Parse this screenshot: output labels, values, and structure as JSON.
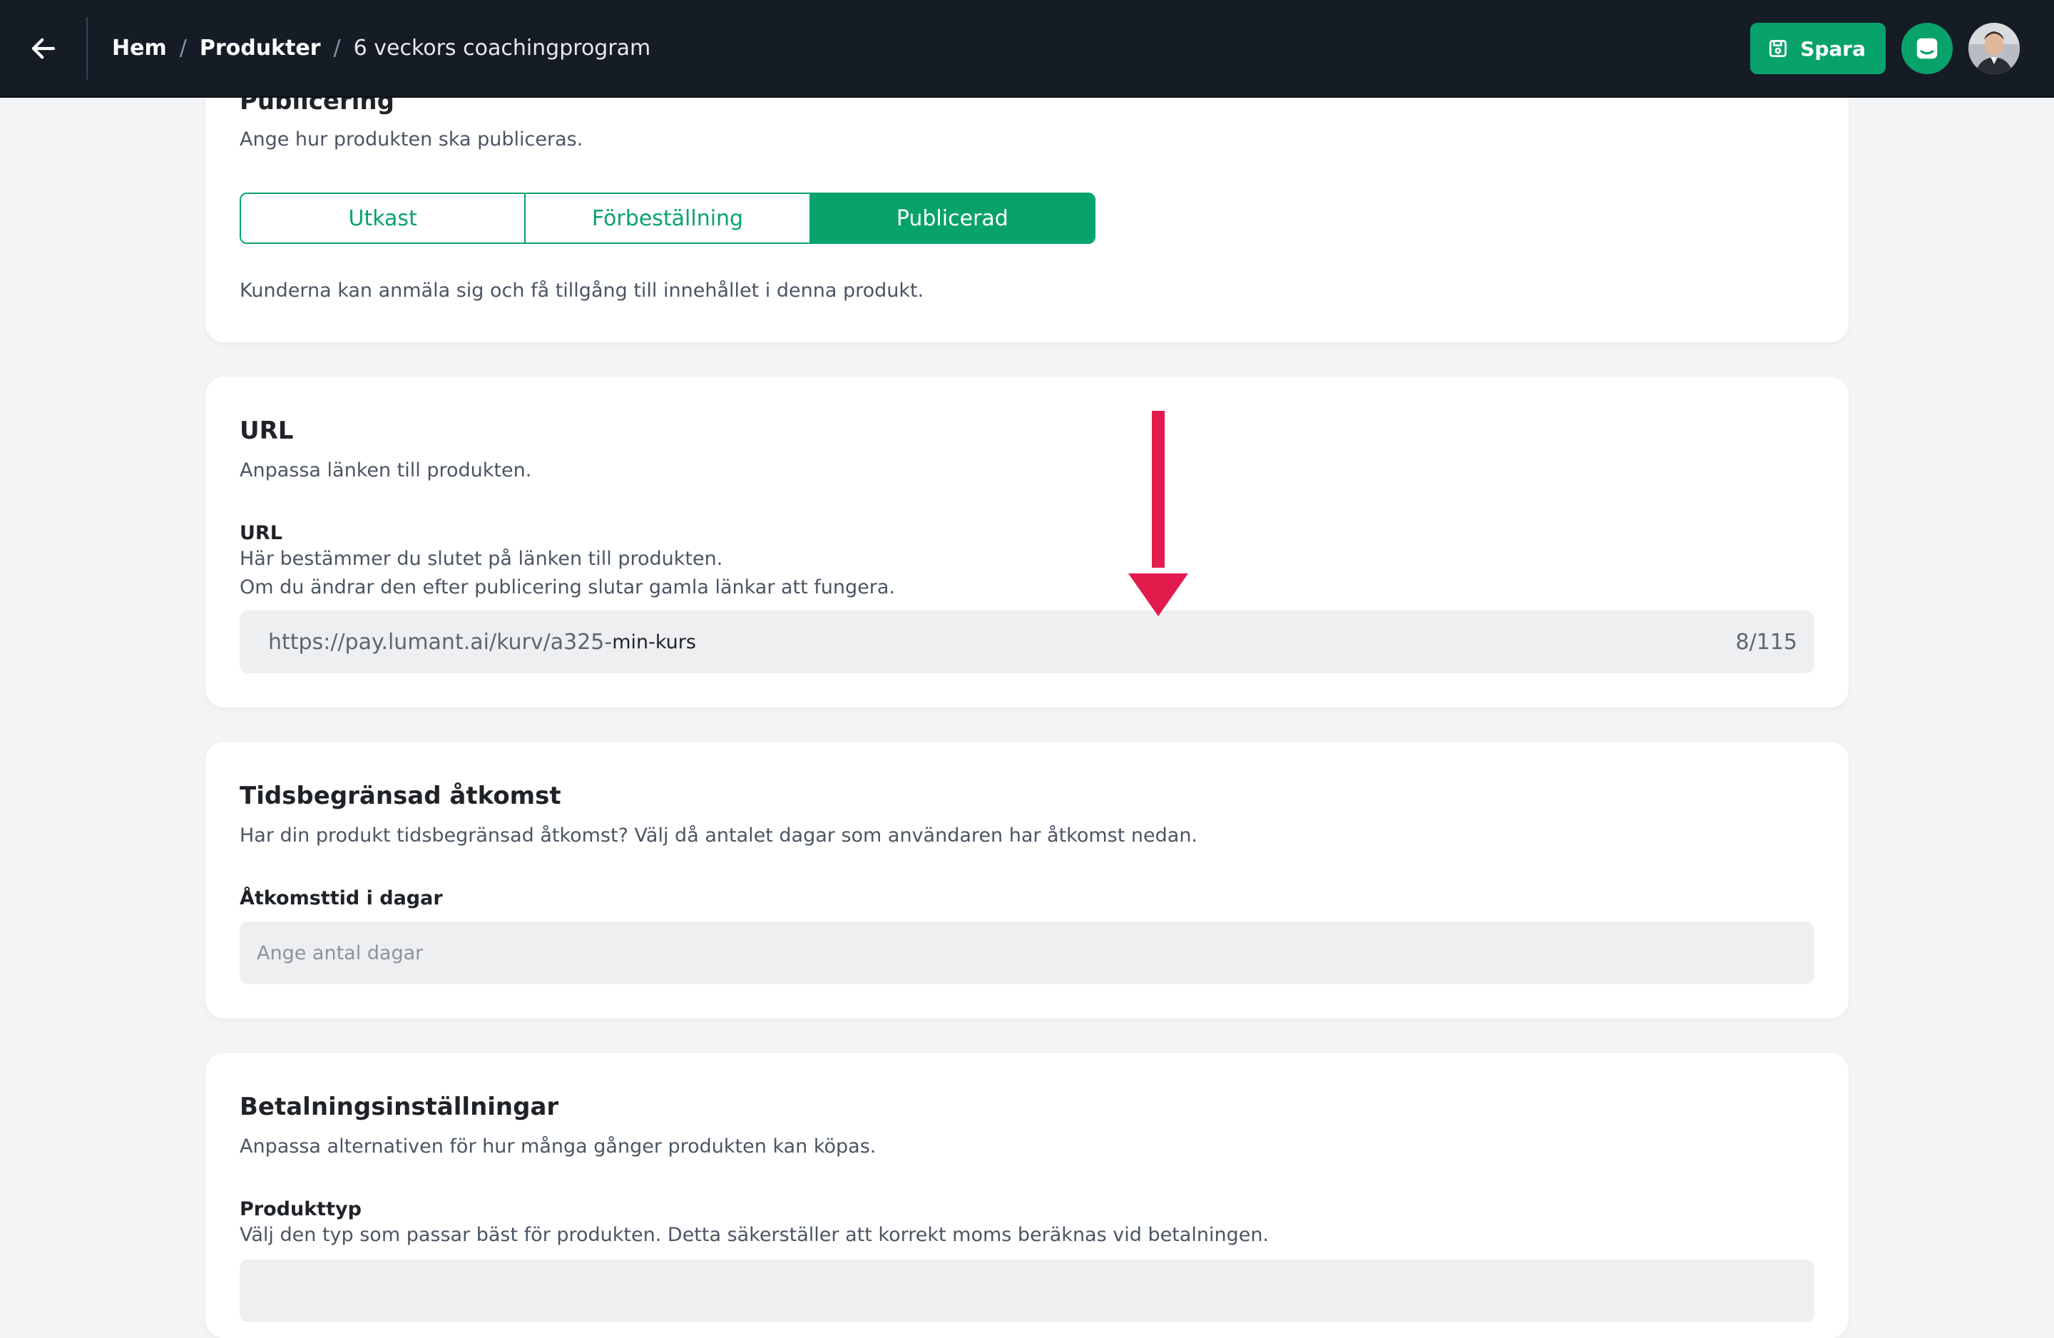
{
  "header": {
    "breadcrumb": [
      {
        "label": "Hem"
      },
      {
        "label": "Produkter"
      },
      {
        "label": "6 veckors coachingprogram"
      }
    ],
    "separator": "/",
    "save_label": "Spara",
    "icons": {
      "back": "arrow-left-icon",
      "save": "save-icon",
      "chat": "chat-icon"
    }
  },
  "publishing": {
    "title": "Publicering",
    "description": "Ange hur produkten ska publiceras.",
    "options": [
      "Utkast",
      "Förbeställning",
      "Publicerad"
    ],
    "selected": "Publicerad",
    "status_text": "Kunderna kan anmäla sig och få tillgång till innehållet i denna produkt."
  },
  "url_section": {
    "title": "URL",
    "description": "Anpassa länken till produkten.",
    "field_label": "URL",
    "help_line1": "Här bestämmer du slutet på länken till produkten.",
    "help_line2": "Om du ändrar den efter publicering slutar gamla länkar att fungera.",
    "prefix": "https://pay.lumant.ai/kurv/a325-",
    "value": "min-kurs",
    "counter": "8/115"
  },
  "access": {
    "title": "Tidsbegränsad åtkomst",
    "description": "Har din produkt tidsbegränsad åtkomst? Välj då antalet dagar som användaren har åtkomst nedan.",
    "field_label": "Åtkomsttid i dagar",
    "placeholder": "Ange antal dagar"
  },
  "payment": {
    "title": "Betalningsinställningar",
    "description": "Anpassa alternativen för hur många gånger produkten kan köpas.",
    "field_label": "Produkttyp",
    "field_help": "Välj den typ som passar bäst för produkten. Detta säkerställer att korrekt moms beräknas vid betalningen."
  },
  "colors": {
    "topbar": "#161c26",
    "accent": "#08a36b",
    "annotation": "#e31b4d",
    "page_bg": "#f3f4f6"
  }
}
